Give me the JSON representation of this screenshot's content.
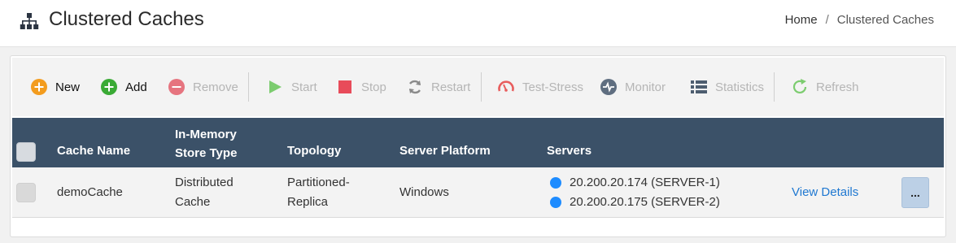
{
  "header": {
    "title": "Clustered Caches",
    "title_icon": "sitemap-icon",
    "breadcrumb": {
      "home": "Home",
      "separator": "/",
      "current": "Clustered Caches"
    }
  },
  "toolbar": {
    "new_label": "New",
    "add_label": "Add",
    "remove_label": "Remove",
    "start_label": "Start",
    "stop_label": "Stop",
    "restart_label": "Restart",
    "test_stress_label": "Test-Stress",
    "monitor_label": "Monitor",
    "statistics_label": "Statistics",
    "refresh_label": "Refresh"
  },
  "grid": {
    "columns": {
      "cache_name": "Cache Name",
      "store_type_line1": "In-Memory",
      "store_type_line2": "Store Type",
      "topology": "Topology",
      "server_platform": "Server Platform",
      "servers": "Servers"
    },
    "rows": [
      {
        "cache_name": "demoCache",
        "store_type_line1": "Distributed",
        "store_type_line2": "Cache",
        "topology_line1": "Partitioned-",
        "topology_line2": "Replica",
        "server_platform": "Windows",
        "servers": [
          "20.200.20.174 (SERVER-1)",
          "20.200.20.175 (SERVER-2)"
        ],
        "view_details": "View Details",
        "more": "..."
      }
    ]
  },
  "colors": {
    "header_bg": "#3b5168",
    "server_dot": "#1e8cff",
    "new_icon": "#f39c1e",
    "add_icon": "#3aaa35",
    "remove_icon": "#e35d6a",
    "start_icon": "#7ccc6f",
    "stop_icon": "#e84b5a",
    "link": "#1f78d1"
  }
}
